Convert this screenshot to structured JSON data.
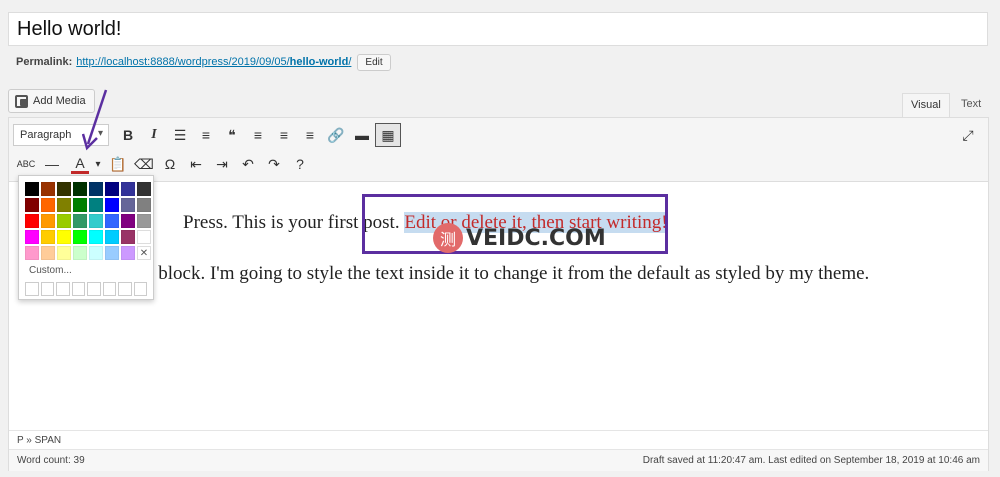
{
  "post": {
    "title": "Hello world!",
    "permalink_label": "Permalink:",
    "permalink_url_base": "http://localhost:8888/wordpress/2019/09/05/",
    "permalink_slug": "hello-world",
    "permalink_url_end": "/",
    "edit_label": "Edit"
  },
  "media": {
    "add_media_label": "Add Media"
  },
  "editor_tabs": {
    "visual": "Visual",
    "text": "Text"
  },
  "toolbar": {
    "format_select": "Paragraph",
    "row1": [
      {
        "name": "bold-icon",
        "glyph": "B"
      },
      {
        "name": "italic-icon",
        "glyph": "I"
      },
      {
        "name": "bulleted-list-icon",
        "glyph": "☰"
      },
      {
        "name": "numbered-list-icon",
        "glyph": "≡"
      },
      {
        "name": "blockquote-icon",
        "glyph": "❝"
      },
      {
        "name": "align-left-icon",
        "glyph": "≡"
      },
      {
        "name": "align-center-icon",
        "glyph": "≡"
      },
      {
        "name": "align-right-icon",
        "glyph": "≡"
      },
      {
        "name": "link-icon",
        "glyph": "🔗"
      },
      {
        "name": "read-more-icon",
        "glyph": "▬"
      },
      {
        "name": "toolbar-toggle-icon",
        "glyph": "▦"
      }
    ],
    "row2": [
      {
        "name": "strikethrough-icon",
        "glyph": "ABC"
      },
      {
        "name": "horizontal-line-icon",
        "glyph": "—"
      },
      {
        "name": "text-color-icon",
        "glyph": "A"
      },
      {
        "name": "text-color-dropdown-icon",
        "glyph": "▾"
      },
      {
        "name": "paste-as-text-icon",
        "glyph": "📋"
      },
      {
        "name": "clear-formatting-icon",
        "glyph": "⌫"
      },
      {
        "name": "special-character-icon",
        "glyph": "Ω"
      },
      {
        "name": "decrease-indent-icon",
        "glyph": "⇤"
      },
      {
        "name": "increase-indent-icon",
        "glyph": "⇥"
      },
      {
        "name": "undo-icon",
        "glyph": "↶"
      },
      {
        "name": "redo-icon",
        "glyph": "↷"
      },
      {
        "name": "help-icon",
        "glyph": "?"
      }
    ],
    "fullscreen_icon": "⤢"
  },
  "content": {
    "p1_visible": "Press. This is your first post. ",
    "p1_highlight": "Edit or delete it, then start writing!",
    "p2_visible": "n block. I'm going to style the text inside it to change it from the default as styled by my theme."
  },
  "watermark": {
    "logo": "测",
    "text": "VEIDC.COM"
  },
  "colors": {
    "swatches": [
      "#000000",
      "#993300",
      "#333300",
      "#003300",
      "#003366",
      "#000080",
      "#333399",
      "#333333",
      "#800000",
      "#ff6600",
      "#808000",
      "#008000",
      "#008080",
      "#0000ff",
      "#666699",
      "#808080",
      "#ff0000",
      "#ff9900",
      "#99cc00",
      "#339966",
      "#33cccc",
      "#3366ff",
      "#800080",
      "#999999",
      "#ff00ff",
      "#ffcc00",
      "#ffff00",
      "#00ff00",
      "#00ffff",
      "#00ccff",
      "#993366",
      "blank",
      "#ff99cc",
      "#ffcc99",
      "#ffff99",
      "#ccffcc",
      "#ccffff",
      "#99ccff",
      "#cc99ff",
      "remove"
    ],
    "remove_glyph": "✕",
    "custom_label": "Custom...",
    "custom_slots": 8,
    "highlight_text": "#c32a2a",
    "highlight_border": "#5b2fa0"
  },
  "status": {
    "path": "P » SPAN",
    "word_count": "Word count: 39",
    "draft_status": "Draft saved at 11:20:47 am. Last edited on September 18, 2019 at 10:46 am"
  }
}
